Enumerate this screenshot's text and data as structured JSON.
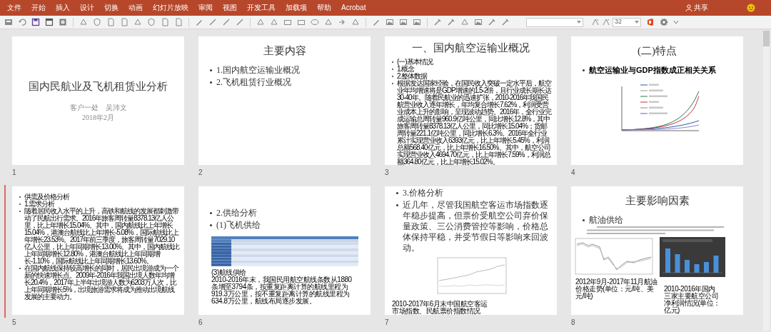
{
  "menu_tabs": [
    {
      "label": "文件"
    },
    {
      "label": "开始"
    },
    {
      "label": "插入"
    },
    {
      "label": "设计"
    },
    {
      "label": "切换"
    },
    {
      "label": "动画"
    },
    {
      "label": "幻灯片放映"
    },
    {
      "label": "审阅"
    },
    {
      "label": "视图"
    },
    {
      "label": "开发工具"
    },
    {
      "label": "加载项"
    },
    {
      "label": "帮助"
    },
    {
      "label": "Acrobat"
    }
  ],
  "share": {
    "label": "共享"
  },
  "toolbar": {
    "font_size": "32"
  },
  "slides": [
    {
      "number": "1",
      "kind": "title",
      "insert_marker": false,
      "title": "国内民航业及飞机租赁业分析",
      "subtitle": [
        "客户一处　吴沛文",
        "2018年2月"
      ]
    },
    {
      "number": "2",
      "kind": "content",
      "insert_marker": false,
      "title": "主要内容",
      "bullets": [
        {
          "text": "1.国内航空运输业概况",
          "kind": "large"
        },
        {
          "text": "2.飞机租赁行业概况",
          "kind": "large"
        }
      ]
    },
    {
      "number": "3",
      "kind": "content",
      "insert_marker": false,
      "title": "一、国内航空运输业概况",
      "bullets": [
        {
          "text": "(一)基本情况",
          "kind": "small"
        },
        {
          "text": "1.概念",
          "kind": "small"
        },
        {
          "text": "2.整体数据",
          "kind": "small"
        },
        {
          "text": "根据发达国家经验，在国民收入突破一定水平后，航空业年均增速将是GDP增速的1.5-2倍，且行业成长期长达30-40年。随着民航业的迅速扩张，2010-2016年我国民航营业收入逐年增长，年均复合增长7.62%，利润受营业成本上升的影响，呈现波动趋势。2016年，全行业完成运输总周转量960.9亿吨公里，同比增长12.8%，其中旅客周转量8378.13亿人公里，同比增长15.04%；货邮周转量221.1亿吨公里，同比增长6.3%。2016年全行业累计实现营业收入6393亿元，比上年增长5.45%，利润总额568.40亿元，比上年增长16.50%。其中，航空公司实现营业收入4694.70亿元，比上年增长7.59%，利润总额364.80亿元，比上年增长15.02%。",
          "kind": "small"
        }
      ]
    },
    {
      "number": "4",
      "kind": "content",
      "insert_marker": false,
      "title": "(二)特点",
      "bullets": [
        {
          "text": "航空运输业与GDP指数成正相关关系",
          "kind": "bold"
        }
      ],
      "figures": [
        {
          "kind": "multi-line-chart"
        }
      ]
    },
    {
      "number": "5",
      "kind": "content",
      "insert_marker": true,
      "bullets": [
        {
          "text": "供需及价格分析",
          "kind": "small"
        },
        {
          "text": "1.需求分析",
          "kind": "small"
        },
        {
          "text": "随着居民收入水平的上升，高铁和航线的发展都刺激带动了民航出行需求。2016年旅客周转量8378.13亿人公里，比上年增长15.04%。其中，国内航线比上年增长15.04%，港澳台航线比上年增长-5.08%，国际航线比上年增长23.53%。2017年前三季度，旅客周转量7029.10亿人公里，比上年同期增长13.00%。其中，国内航线比上年同期增长12.80%，港澳台航线比上年同期增长-1.10%，国际航线比上年同期增长13.60%。",
          "kind": "small"
        },
        {
          "text": "在国内航线保持较高增长的同时，居民出境游成为一个新的快速增长点。2009年-2016年我国出境人数年均增长20.4%，2017年上半年出境游人数为6203万人次，比上年同期增长5%，出境旅游需求将成为推动出境航线发展的主要动力。",
          "kind": "small"
        }
      ]
    },
    {
      "number": "6",
      "kind": "content",
      "insert_marker": false,
      "bullets": [
        {
          "text": "2.供给分析",
          "kind": "large"
        },
        {
          "text": "(1)飞机供给",
          "kind": "large"
        }
      ],
      "figures": [
        {
          "kind": "table",
          "caption": [
            "(3)航线供给",
            "2010-2016年末，我国民用航空航线条数从1880条增至3794条，按重复距离计算的航线里程为919.3万公里，按不重复距离计算的航线里程为634.8万公里，航线布局逐步发展。"
          ]
        }
      ]
    },
    {
      "number": "7",
      "kind": "content",
      "insert_marker": false,
      "bullets": [
        {
          "text": "3.价格分析",
          "kind": "large"
        },
        {
          "text": "近几年，尽管我国航空客运市场指数逐年稳步提高，但票价受航空公司弃价保量政策、三公消费管控等影响，价格总体保持平稳，并受节假日等影响来回波动。",
          "kind": "large"
        }
      ],
      "figures": [
        {
          "kind": "line-chart",
          "caption": [
            "2010-2017年6月末中国航空客运市场指数、民航票价指数情况"
          ]
        }
      ]
    },
    {
      "number": "8",
      "kind": "content",
      "insert_marker": false,
      "title": "主要影响因素",
      "bullets": [
        {
          "text": "航油供给",
          "kind": "large"
        }
      ],
      "figures": [
        {
          "kind": "line-chart",
          "caption": [
            "2012年9月-2017年11月航油价格走势(单位：元/吨、美元/吨)"
          ]
        },
        {
          "kind": "bar-chart",
          "caption": [
            "2010-2016年国内三家主要航空公司净利润情况(单位：亿元)"
          ]
        }
      ]
    }
  ]
}
